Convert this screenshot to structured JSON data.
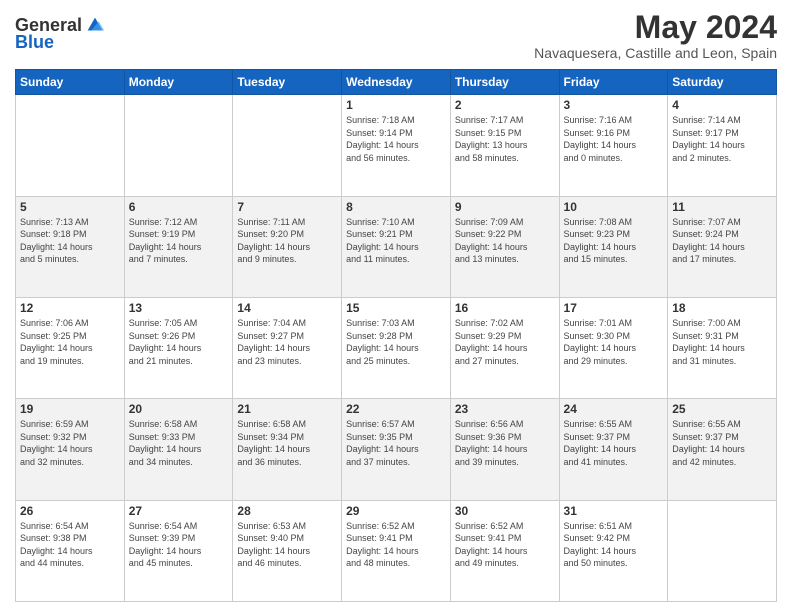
{
  "header": {
    "logo_general": "General",
    "logo_blue": "Blue",
    "month_title": "May 2024",
    "location": "Navaquesera, Castille and Leon, Spain"
  },
  "calendar": {
    "days_of_week": [
      "Sunday",
      "Monday",
      "Tuesday",
      "Wednesday",
      "Thursday",
      "Friday",
      "Saturday"
    ],
    "weeks": [
      [
        {
          "day": "",
          "info": ""
        },
        {
          "day": "",
          "info": ""
        },
        {
          "day": "",
          "info": ""
        },
        {
          "day": "1",
          "info": "Sunrise: 7:18 AM\nSunset: 9:14 PM\nDaylight: 14 hours\nand 56 minutes."
        },
        {
          "day": "2",
          "info": "Sunrise: 7:17 AM\nSunset: 9:15 PM\nDaylight: 13 hours\nand 58 minutes."
        },
        {
          "day": "3",
          "info": "Sunrise: 7:16 AM\nSunset: 9:16 PM\nDaylight: 14 hours\nand 0 minutes."
        },
        {
          "day": "4",
          "info": "Sunrise: 7:14 AM\nSunset: 9:17 PM\nDaylight: 14 hours\nand 2 minutes."
        }
      ],
      [
        {
          "day": "5",
          "info": "Sunrise: 7:13 AM\nSunset: 9:18 PM\nDaylight: 14 hours\nand 5 minutes."
        },
        {
          "day": "6",
          "info": "Sunrise: 7:12 AM\nSunset: 9:19 PM\nDaylight: 14 hours\nand 7 minutes."
        },
        {
          "day": "7",
          "info": "Sunrise: 7:11 AM\nSunset: 9:20 PM\nDaylight: 14 hours\nand 9 minutes."
        },
        {
          "day": "8",
          "info": "Sunrise: 7:10 AM\nSunset: 9:21 PM\nDaylight: 14 hours\nand 11 minutes."
        },
        {
          "day": "9",
          "info": "Sunrise: 7:09 AM\nSunset: 9:22 PM\nDaylight: 14 hours\nand 13 minutes."
        },
        {
          "day": "10",
          "info": "Sunrise: 7:08 AM\nSunset: 9:23 PM\nDaylight: 14 hours\nand 15 minutes."
        },
        {
          "day": "11",
          "info": "Sunrise: 7:07 AM\nSunset: 9:24 PM\nDaylight: 14 hours\nand 17 minutes."
        }
      ],
      [
        {
          "day": "12",
          "info": "Sunrise: 7:06 AM\nSunset: 9:25 PM\nDaylight: 14 hours\nand 19 minutes."
        },
        {
          "day": "13",
          "info": "Sunrise: 7:05 AM\nSunset: 9:26 PM\nDaylight: 14 hours\nand 21 minutes."
        },
        {
          "day": "14",
          "info": "Sunrise: 7:04 AM\nSunset: 9:27 PM\nDaylight: 14 hours\nand 23 minutes."
        },
        {
          "day": "15",
          "info": "Sunrise: 7:03 AM\nSunset: 9:28 PM\nDaylight: 14 hours\nand 25 minutes."
        },
        {
          "day": "16",
          "info": "Sunrise: 7:02 AM\nSunset: 9:29 PM\nDaylight: 14 hours\nand 27 minutes."
        },
        {
          "day": "17",
          "info": "Sunrise: 7:01 AM\nSunset: 9:30 PM\nDaylight: 14 hours\nand 29 minutes."
        },
        {
          "day": "18",
          "info": "Sunrise: 7:00 AM\nSunset: 9:31 PM\nDaylight: 14 hours\nand 31 minutes."
        }
      ],
      [
        {
          "day": "19",
          "info": "Sunrise: 6:59 AM\nSunset: 9:32 PM\nDaylight: 14 hours\nand 32 minutes."
        },
        {
          "day": "20",
          "info": "Sunrise: 6:58 AM\nSunset: 9:33 PM\nDaylight: 14 hours\nand 34 minutes."
        },
        {
          "day": "21",
          "info": "Sunrise: 6:58 AM\nSunset: 9:34 PM\nDaylight: 14 hours\nand 36 minutes."
        },
        {
          "day": "22",
          "info": "Sunrise: 6:57 AM\nSunset: 9:35 PM\nDaylight: 14 hours\nand 37 minutes."
        },
        {
          "day": "23",
          "info": "Sunrise: 6:56 AM\nSunset: 9:36 PM\nDaylight: 14 hours\nand 39 minutes."
        },
        {
          "day": "24",
          "info": "Sunrise: 6:55 AM\nSunset: 9:37 PM\nDaylight: 14 hours\nand 41 minutes."
        },
        {
          "day": "25",
          "info": "Sunrise: 6:55 AM\nSunset: 9:37 PM\nDaylight: 14 hours\nand 42 minutes."
        }
      ],
      [
        {
          "day": "26",
          "info": "Sunrise: 6:54 AM\nSunset: 9:38 PM\nDaylight: 14 hours\nand 44 minutes."
        },
        {
          "day": "27",
          "info": "Sunrise: 6:54 AM\nSunset: 9:39 PM\nDaylight: 14 hours\nand 45 minutes."
        },
        {
          "day": "28",
          "info": "Sunrise: 6:53 AM\nSunset: 9:40 PM\nDaylight: 14 hours\nand 46 minutes."
        },
        {
          "day": "29",
          "info": "Sunrise: 6:52 AM\nSunset: 9:41 PM\nDaylight: 14 hours\nand 48 minutes."
        },
        {
          "day": "30",
          "info": "Sunrise: 6:52 AM\nSunset: 9:41 PM\nDaylight: 14 hours\nand 49 minutes."
        },
        {
          "day": "31",
          "info": "Sunrise: 6:51 AM\nSunset: 9:42 PM\nDaylight: 14 hours\nand 50 minutes."
        },
        {
          "day": "",
          "info": ""
        }
      ]
    ]
  }
}
